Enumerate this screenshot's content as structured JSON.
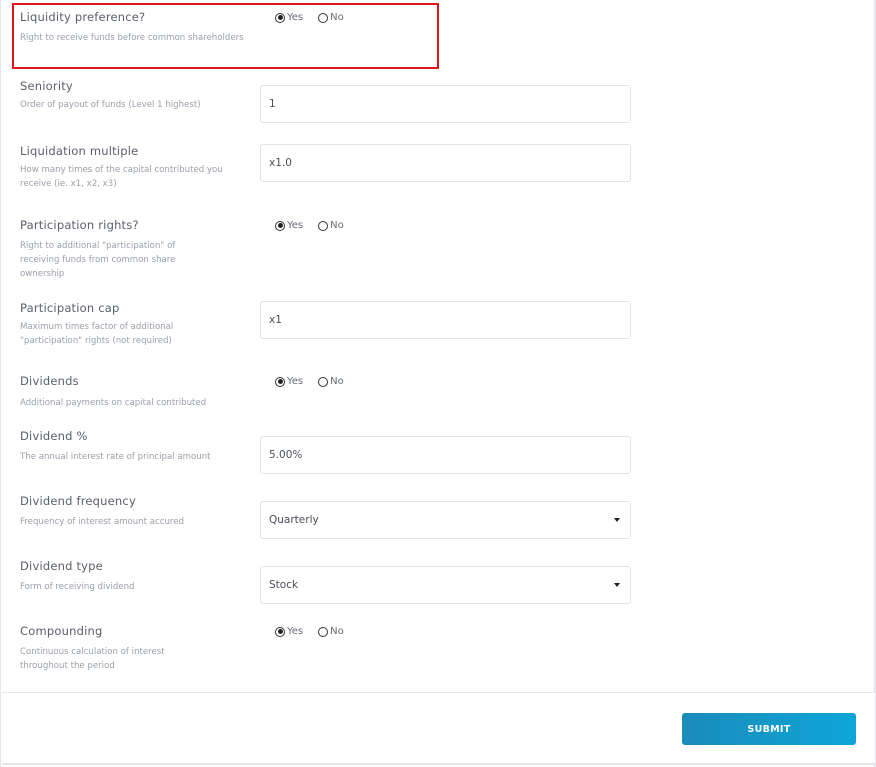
{
  "form": {
    "radio_yes": "Yes",
    "radio_no": "No",
    "liquidity": {
      "label": "Liquidity preference?",
      "help": "Right to receive funds before common shareholders",
      "value": "Yes"
    },
    "seniority": {
      "label": "Seniority",
      "help": "Order of payout of funds (Level 1 highest)",
      "value": "1"
    },
    "liquidation_multiple": {
      "label": "Liquidation multiple",
      "help": "How many times of the capital contributed you receive (ie. x1, x2, x3)",
      "value": "x1.0"
    },
    "participation_rights": {
      "label": "Participation rights?",
      "help": "Right to additional \"participation\" of receiving funds from common share ownership",
      "value": "Yes"
    },
    "participation_cap": {
      "label": "Participation cap",
      "help": "Maximum times factor of additional \"participation\" rights (not required)",
      "value": "x1"
    },
    "dividends": {
      "label": "Dividends",
      "help": "Additional payments on capital contributed",
      "value": "Yes"
    },
    "dividend_pct": {
      "label": "Dividend %",
      "help": "The annual interest rate of principal amount",
      "value": "5.00%"
    },
    "dividend_frequency": {
      "label": "Dividend frequency",
      "help": "Frequency of interest amount accured",
      "value": "Quarterly"
    },
    "dividend_type": {
      "label": "Dividend type",
      "help": "Form of receiving dividend",
      "value": "Stock"
    },
    "compounding": {
      "label": "Compounding",
      "help": "Continuous calculation of interest throughout the period",
      "value": "Yes"
    }
  },
  "footer": {
    "submit_label": "SUBMIT"
  },
  "colors": {
    "highlight": "#e0141e",
    "submit_start": "#1a8bbb",
    "submit_end": "#0ea6d8"
  }
}
